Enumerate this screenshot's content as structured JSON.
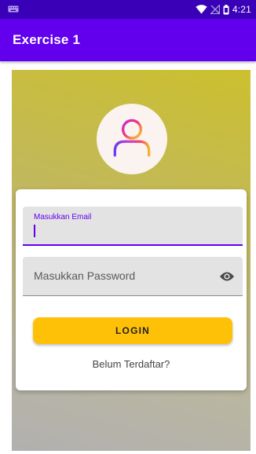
{
  "status_bar": {
    "time": "4:21",
    "icons": [
      "keyboard-icon",
      "wifi-icon",
      "no-signal-icon",
      "battery-icon"
    ]
  },
  "app_bar": {
    "title": "Exercise 1"
  },
  "login_form": {
    "avatar_icon": "user-icon",
    "email_field": {
      "label": "Masukkan Email",
      "value": ""
    },
    "password_field": {
      "placeholder": "Masukkan Password",
      "value": "",
      "toggle_icon": "eye-icon"
    },
    "login_button": {
      "label": "LOGIN"
    },
    "register_link": {
      "label": "Belum Terdaftar?"
    }
  },
  "colors": {
    "primary": "#6200ee",
    "primary_dark": "#3a00b8",
    "accent": "#ffc107"
  }
}
